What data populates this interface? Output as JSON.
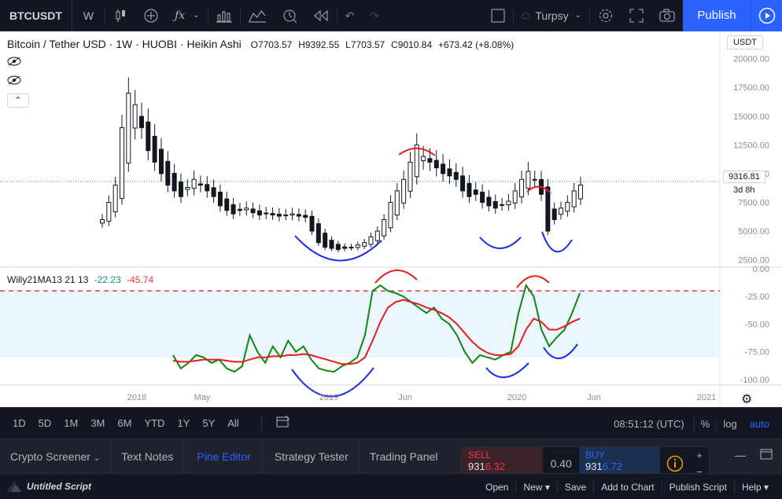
{
  "toolbar": {
    "symbol": "BTCUSDT",
    "interval": "W",
    "cloud_label": "Turpsy",
    "publish_label": "Publish"
  },
  "legend": {
    "title": "Bitcoin / Tether USD · 1W · HUOBI · Heikin Ashi",
    "open": "O7703.57",
    "high": "H9392.55",
    "low": "L7703.57",
    "close": "C9010.84",
    "change": "+673.42 (+8.08%)"
  },
  "indicator": {
    "name": "Willy21MA13 21 13",
    "value1": "-22.23",
    "value2": "-45.74"
  },
  "price_axis": {
    "currency_badge": "USDT",
    "ticks": [
      "20000.00",
      "17500.00",
      "15000.00",
      "12500.00",
      "10000.00",
      "7500.00",
      "5000.00",
      "2500.00"
    ],
    "current_price": "9316.81",
    "countdown": "3d 8h"
  },
  "indicator_axis": {
    "ticks": [
      "0.00",
      "-25.00",
      "-50.00",
      "-75.00",
      "-100.00"
    ]
  },
  "time_axis": {
    "labels": [
      "2018",
      "May",
      "2019",
      "Jun",
      "2020",
      "Jun",
      "2021"
    ]
  },
  "rangebar": {
    "ranges": [
      "1D",
      "5D",
      "1M",
      "3M",
      "6M",
      "YTD",
      "1Y",
      "5Y",
      "All"
    ],
    "clock": "08:51:12 (UTC)",
    "percent": "%",
    "log": "log",
    "auto": "auto"
  },
  "tabs": {
    "items": [
      "Crypto Screener",
      "Text Notes",
      "Pine Editor",
      "Strategy Tester",
      "Trading Panel"
    ],
    "active": "Pine Editor"
  },
  "trade": {
    "sell_label": "SELL",
    "sell_price_prefix": "931",
    "sell_price_big": "6.32",
    "spread": "0.40",
    "buy_label": "BUY",
    "buy_price_prefix": "931",
    "buy_price_big": "6.72"
  },
  "script": {
    "name": "Untitled Script",
    "actions": [
      "Open",
      "New",
      "Save",
      "Add to Chart",
      "Publish Script",
      "Help"
    ]
  },
  "chart_data": {
    "type": "line",
    "panes": [
      {
        "name": "price",
        "chart": "heikin-ashi candles",
        "ylim": [
          2000,
          21000
        ],
        "current_price": 9316.81,
        "candles_approx_close": [
          6000,
          7500,
          9000,
          14000,
          17000,
          16000,
          14000,
          12000,
          11000,
          10000,
          9000,
          8500,
          8000,
          8800,
          9500,
          9000,
          8500,
          8000,
          7200,
          6800,
          6500,
          6800,
          7000,
          6600,
          6400,
          6500,
          6400,
          6300,
          6400,
          6500,
          6300,
          6200,
          5000,
          4000,
          3600,
          3500,
          3400,
          3500,
          3600,
          3800,
          4000,
          4500,
          5000,
          6000,
          7500,
          8500,
          9500,
          11000,
          12500,
          11500,
          11000,
          10500,
          10000,
          9800,
          9500,
          8500,
          8000,
          8200,
          7500,
          7200,
          7000,
          7300,
          7600,
          8500,
          9500,
          10200,
          9500,
          8200,
          5000,
          6000,
          7000,
          7500,
          8500,
          9010.84
        ]
      },
      {
        "name": "Willy21MA13",
        "ylim": [
          -105,
          0
        ],
        "reference_line": -20,
        "shaded_band": [
          -80,
          -20
        ],
        "series": [
          {
            "name": "Willy",
            "color": "#0a8a0a",
            "values": [
              -78,
              -90,
              -85,
              -78,
              -80,
              -85,
              -82,
              -90,
              -93,
              -88,
              -60,
              -75,
              -85,
              -70,
              -80,
              -65,
              -75,
              -70,
              -82,
              -90,
              -92,
              -93,
              -88,
              -85,
              -80,
              -60,
              -20,
              -15,
              -20,
              -22,
              -25,
              -30,
              -35,
              -40,
              -35,
              -45,
              -50,
              -60,
              -75,
              -85,
              -78,
              -80,
              -82,
              -78,
              -75,
              -40,
              -15,
              -25,
              -55,
              -70,
              -62,
              -55,
              -40,
              -22
            ]
          },
          {
            "name": "MA",
            "color": "#e81c1c",
            "values": [
              -83,
              -84,
              -84,
              -83,
              -82,
              -82,
              -82,
              -83,
              -84,
              -84,
              -82,
              -80,
              -80,
              -79,
              -79,
              -78,
              -78,
              -77,
              -78,
              -80,
              -82,
              -84,
              -86,
              -86,
              -85,
              -80,
              -65,
              -48,
              -35,
              -30,
              -28,
              -30,
              -32,
              -35,
              -37,
              -40,
              -44,
              -50,
              -58,
              -66,
              -72,
              -76,
              -78,
              -78,
              -77,
              -70,
              -55,
              -45,
              -48,
              -55,
              -55,
              -52,
              -48,
              -45
            ]
          }
        ]
      }
    ],
    "annotations": [
      "red arcs over tops",
      "blue arcs under bottoms"
    ],
    "x_labels": [
      "2018",
      "May",
      "2019",
      "Jun",
      "2020",
      "Jun",
      "2021"
    ]
  }
}
